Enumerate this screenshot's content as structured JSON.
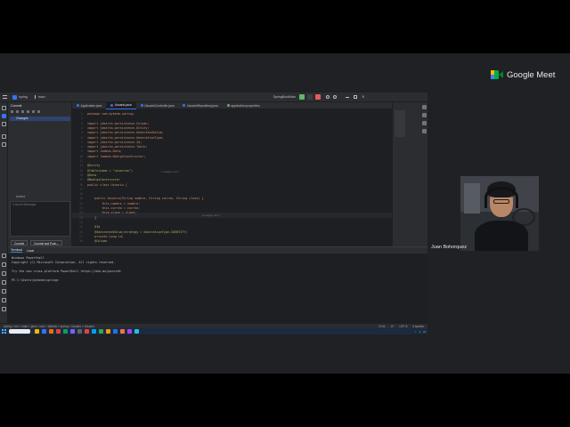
{
  "meeting": {
    "app_name": "Google Meet",
    "participant_name": "Juan Bohorquez",
    "colors": {
      "background": "#202124",
      "logo_green": "#00ac47",
      "logo_blue": "#4285f4",
      "logo_yellow": "#ffba00",
      "logo_red": "#ea4335"
    }
  },
  "ide": {
    "toolbar": {
      "project_label": "spring",
      "branch_label": "main",
      "run_config_label": "SpringBootMain",
      "icons": [
        "hamburger-menu-icon",
        "project-icon",
        "branch-icon",
        "run-icon",
        "debug-icon",
        "stop-icon",
        "search-icon",
        "settings-icon",
        "minimize-icon",
        "maximize-icon",
        "close-icon"
      ]
    },
    "left_tool_icons": [
      "project-icon",
      "commit-icon",
      "structure-icon",
      "bookmarks-icon",
      "pull-requests-icon"
    ],
    "commit_panel": {
      "title": "Commit",
      "changes_label": "Changes",
      "amend_label": "Amend",
      "message_placeholder": "Commit Message",
      "commit_button": "Commit",
      "commit_push_button": "Commit and Push..."
    },
    "editor_tabs": [
      {
        "label": "Application.java",
        "color": "#3574f0",
        "active": false
      },
      {
        "label": "Usuario.java",
        "color": "#3574f0",
        "active": true
      },
      {
        "label": "UsuarioController.java",
        "color": "#3574f0",
        "active": false
      },
      {
        "label": "UsuarioRepository.java",
        "color": "#3574f0",
        "active": false
      },
      {
        "label": "application.properties",
        "color": "#6aab73",
        "active": false
      }
    ],
    "editor": {
      "line_numbers": [
        "1",
        "2",
        "3",
        "4",
        "5",
        "6",
        "7",
        "8",
        "9",
        "10",
        "11",
        "12",
        "13",
        "14",
        "15",
        "16",
        "17",
        "18",
        "19",
        "20",
        "21",
        "22",
        "23",
        "24",
        "25",
        "26",
        "27",
        "28"
      ],
      "lines": [
        "package com.bykedo.spring;",
        "",
        "import jakarta.persistence.Column;",
        "import jakarta.persistence.Entity;",
        "import jakarta.persistence.GeneratedValue;",
        "import jakarta.persistence.GenerationType;",
        "import jakarta.persistence.Id;",
        "import jakarta.persistence.Table;",
        "import lombok.Data;",
        "import lombok.NoArgsConstructor;",
        "",
        "@Entity",
        "@Table(name = \"usuarios\")",
        "@Data",
        "@NoArgsConstructor",
        "public class Usuario {",
        "",
        "",
        "    public Usuario(String nombre, String correo, String clave) {",
        "        this.nombre = nombre;",
        "        this.correo = correo;",
        "        this.clave = clave;",
        "    }",
        "",
        "    @Id",
        "    @GeneratedValue(strategy = GenerationType.IDENTITY)",
        "    private Long id;",
        "    @Column"
      ],
      "inline_hint_1": "7 usages  new *",
      "inline_hint_2": "2 usages  new *"
    },
    "right_tool_icons": [
      "notifications-icon",
      "database-icon",
      "gradle-icon",
      "ai-assistant-icon"
    ],
    "terminal": {
      "tabs": [
        "Terminal",
        "Local"
      ],
      "lines": [
        "Windows PowerShell",
        "Copyright (C) Microsoft Corporation. All rights reserved.",
        "",
        "Try the new cross-platform PowerShell https://aka.ms/pscore6",
        "",
        "PS C:\\Users\\bykedo\\spring> "
      ]
    },
    "status_bar": {
      "breadcrumb": "spring > src > main > java > com > bykedo > spring > Usuario > Usuario",
      "position": "19:11",
      "line_sep": "LF",
      "encoding": "UTF-8",
      "indent": "4 spaces"
    }
  },
  "taskbar": {
    "search_placeholder": "",
    "time": "",
    "app_colors": [
      "#f4b400",
      "#3574f0",
      "#e8710a",
      "#db4437",
      "#0f9d58",
      "#7b61ff",
      "#5f6368",
      "#ea4335",
      "#00a1f1",
      "#34a853",
      "#f29900",
      "#1a73e8",
      "#ff7043",
      "#a142f4",
      "#24c1e0"
    ]
  }
}
